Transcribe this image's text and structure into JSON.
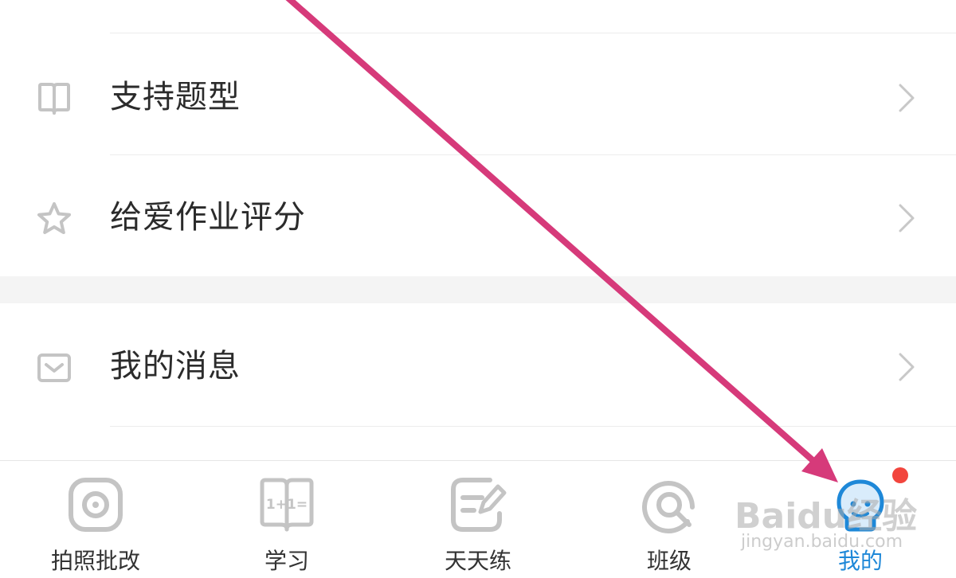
{
  "menu": {
    "items": [
      {
        "label": "支持题型",
        "icon": "book-icon"
      },
      {
        "label": "给爱作业评分",
        "icon": "star-icon"
      },
      {
        "label": "我的消息",
        "icon": "mail-icon"
      }
    ]
  },
  "tabbar": {
    "tabs": [
      {
        "label": "拍照批改",
        "icon": "camera-icon",
        "active": false
      },
      {
        "label": "学习",
        "icon": "math-book-icon",
        "active": false
      },
      {
        "label": "天天练",
        "icon": "practice-edit-icon",
        "active": false
      },
      {
        "label": "班级",
        "icon": "class-icon",
        "active": false
      },
      {
        "label": "我的",
        "icon": "profile-icon",
        "active": true,
        "badge": true
      }
    ]
  },
  "icon_glyphs": {
    "math_book": "1+1="
  },
  "watermark": {
    "logo": "Baidu经验",
    "url": "jingyan.baidu.com"
  },
  "colors": {
    "accent": "#1e88d8",
    "annotation_arrow": "#d63a7a",
    "badge": "#f2453d",
    "icon_gray": "#c4c4c4"
  }
}
